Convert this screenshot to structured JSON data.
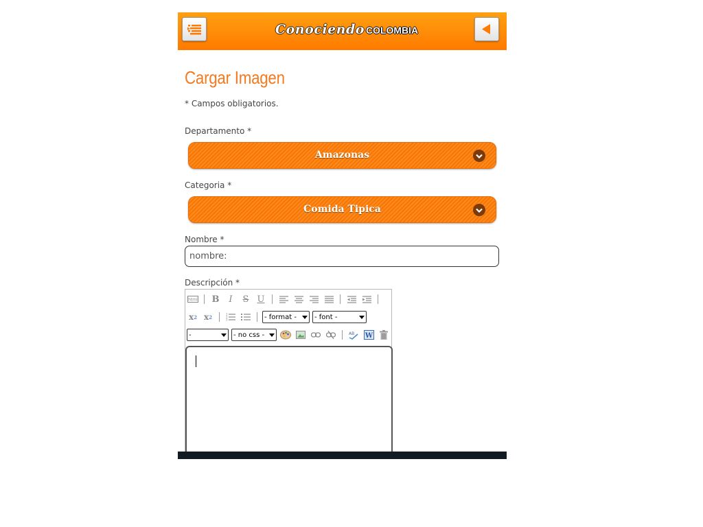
{
  "header": {
    "logo_script": "Conociendo",
    "logo_word": "COLOMBIA",
    "menu_icon": "menu-list-icon",
    "back_icon": "back-arrow-icon"
  },
  "form": {
    "title": "Cargar Imagen",
    "required_note": "* Campos obligatorios.",
    "departamento": {
      "label": "Departamento *",
      "value": "Amazonas"
    },
    "categoria": {
      "label": "Categoria *",
      "value": "Comida Tipica"
    },
    "nombre": {
      "label": "Nombre *",
      "placeholder": "nombre:"
    },
    "descripcion": {
      "label": "Descripción *",
      "format_select": "- format -",
      "font_select": "- font -",
      "size_select": "-",
      "css_select": "- no css -"
    }
  },
  "colors": {
    "accent": "#f47a1f",
    "header_top": "#ffa010",
    "header_bottom": "#ff7a00",
    "select_bg": "#f4760a"
  }
}
